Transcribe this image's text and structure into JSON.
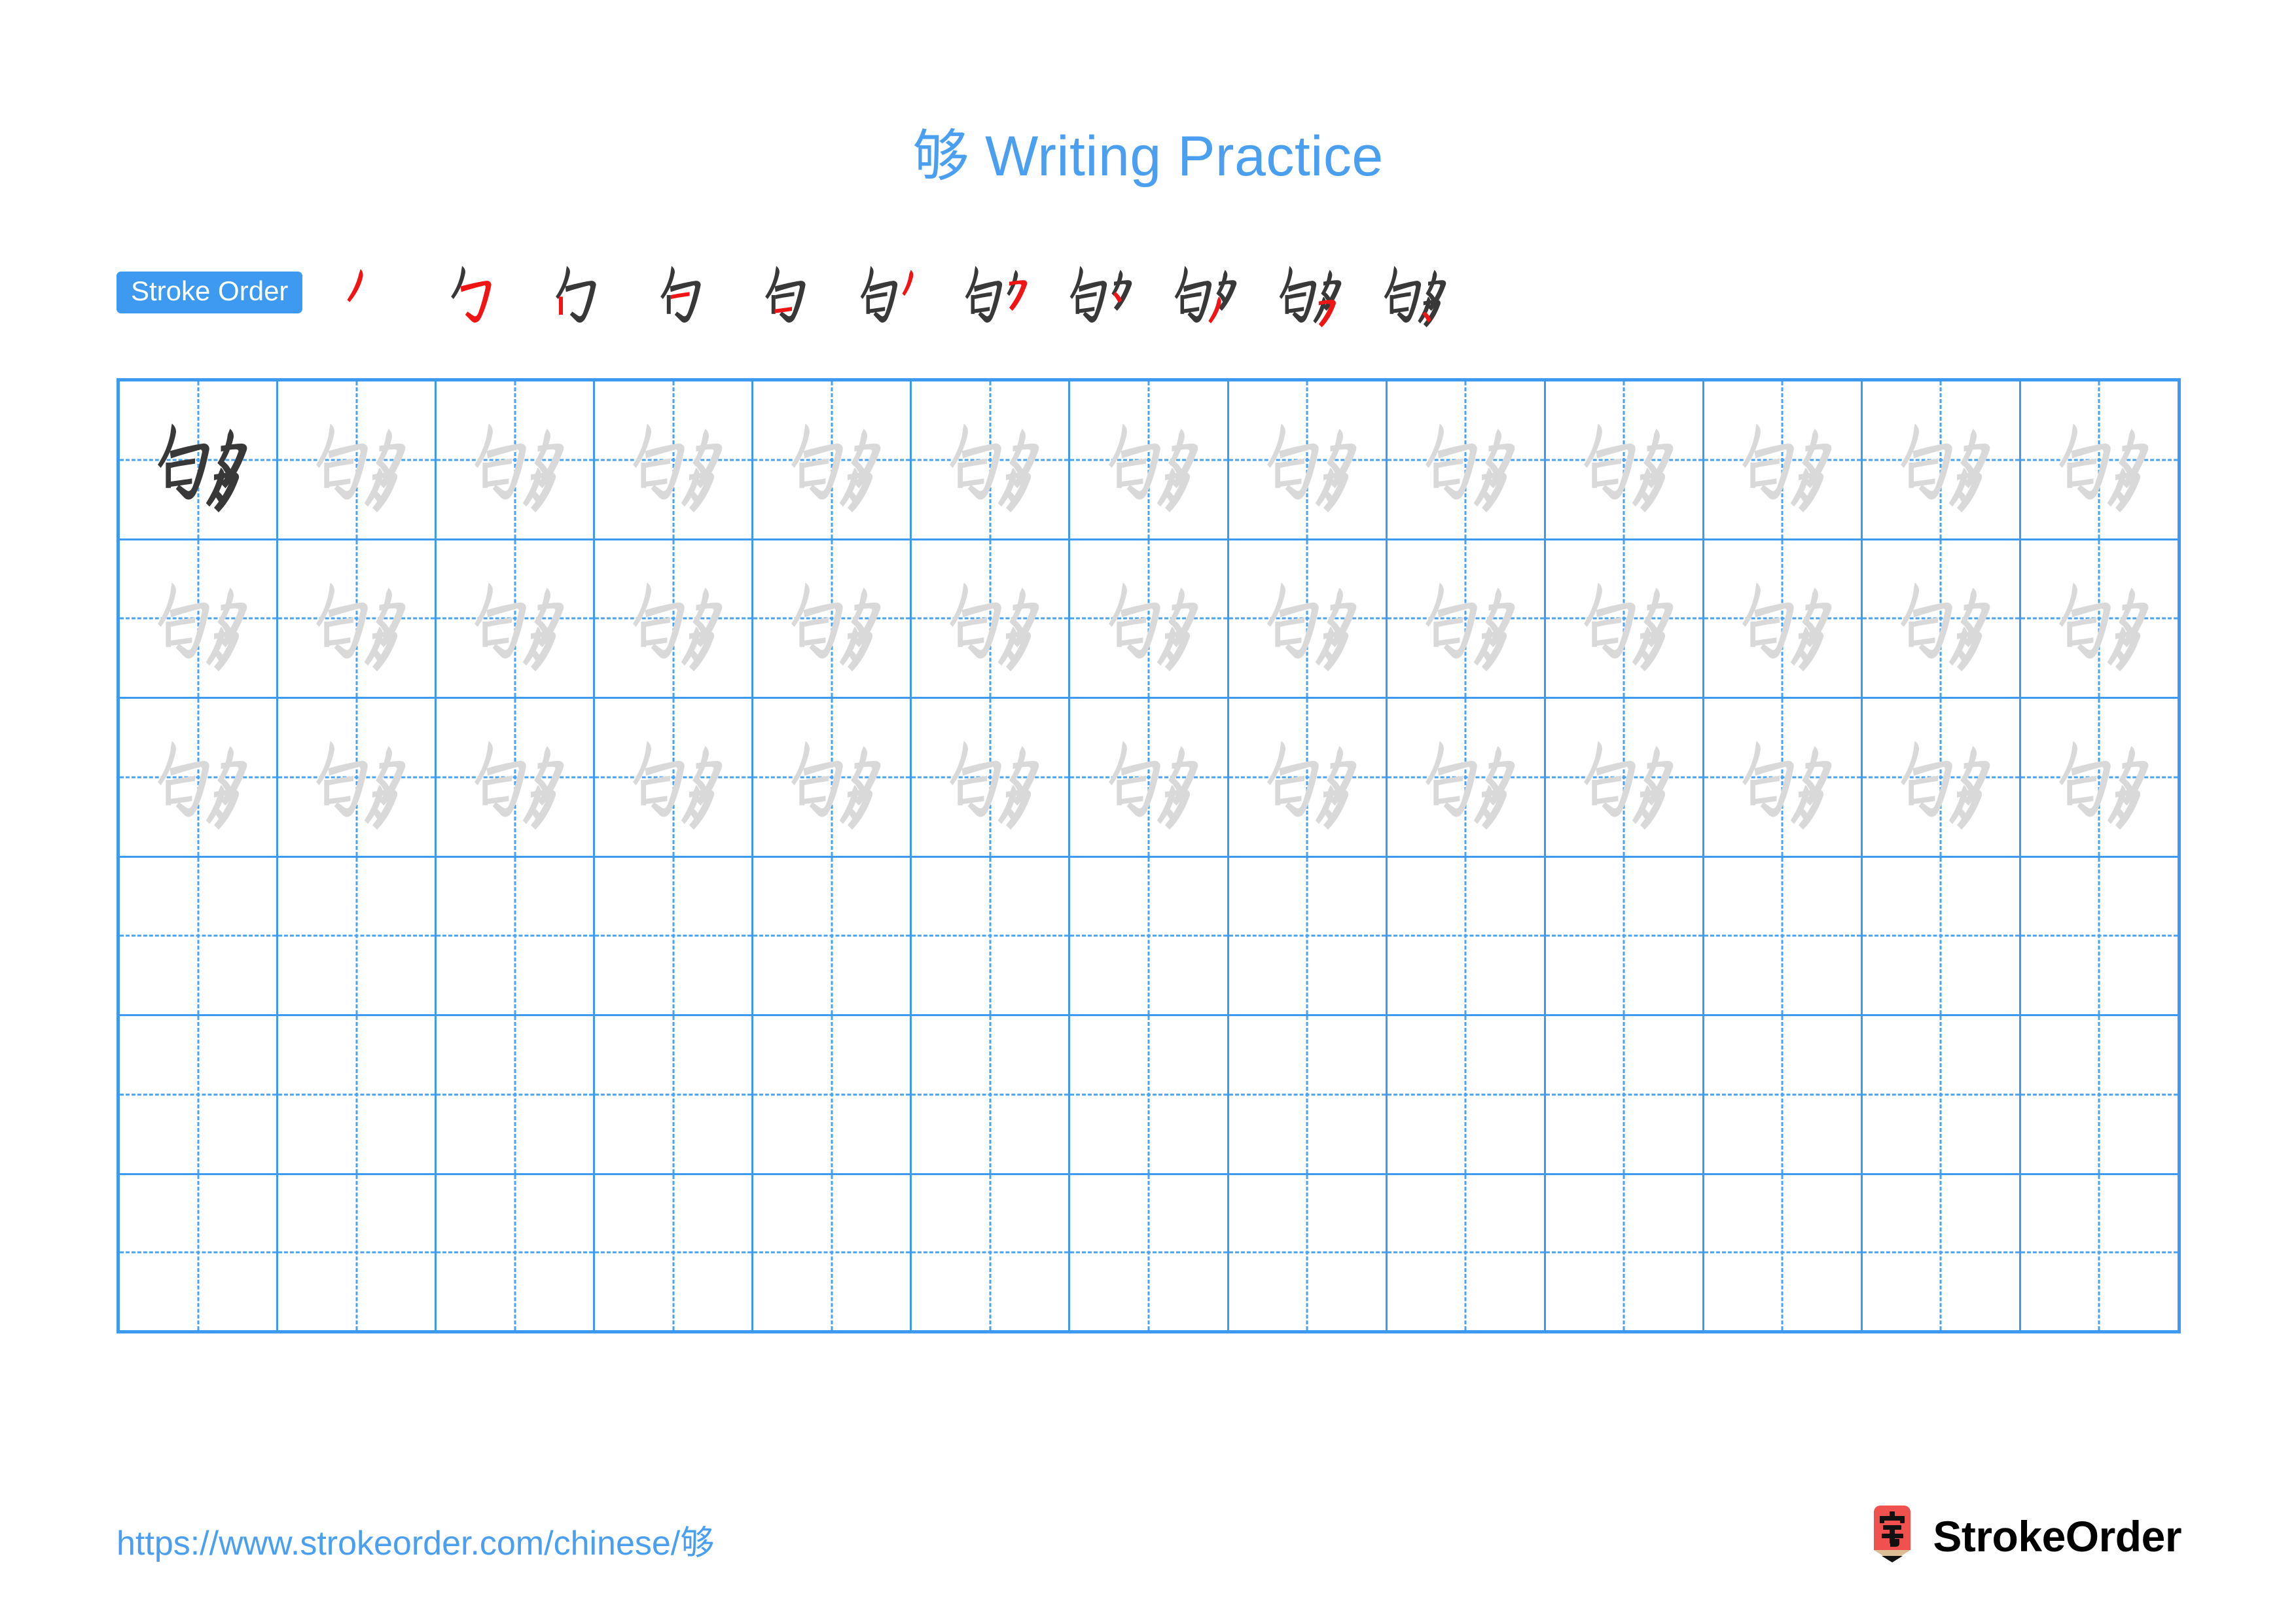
{
  "page": {
    "character": "够",
    "title": "够 Writing Practice",
    "title_character": "够",
    "title_text": " Writing Practice",
    "background_color": "#ffffff",
    "accent_color": "#4a9ff0"
  },
  "stroke_order": {
    "label": "Stroke Order",
    "badge_bg_color": "#3e9af0",
    "badge_text_color": "#ffffff",
    "total_strokes": 11,
    "new_stroke_color": "#f01414",
    "prior_stroke_color": "#383838",
    "steps": [
      {
        "index": 1,
        "strokes_shown": 1,
        "new_stroke_name": "pie"
      },
      {
        "index": 2,
        "strokes_shown": 2,
        "new_stroke_name": "heng-zhe-gou"
      },
      {
        "index": 3,
        "strokes_shown": 3,
        "new_stroke_name": "shu"
      },
      {
        "index": 4,
        "strokes_shown": 4,
        "new_stroke_name": "heng"
      },
      {
        "index": 5,
        "strokes_shown": 5,
        "new_stroke_name": "heng"
      },
      {
        "index": 6,
        "strokes_shown": 6,
        "new_stroke_name": "pie"
      },
      {
        "index": 7,
        "strokes_shown": 7,
        "new_stroke_name": "heng-pie"
      },
      {
        "index": 8,
        "strokes_shown": 8,
        "new_stroke_name": "dian"
      },
      {
        "index": 9,
        "strokes_shown": 9,
        "new_stroke_name": "pie"
      },
      {
        "index": 10,
        "strokes_shown": 10,
        "new_stroke_name": "heng-pie"
      },
      {
        "index": 11,
        "strokes_shown": 11,
        "new_stroke_name": "dian"
      }
    ]
  },
  "practice_grid": {
    "columns": 13,
    "rows": 6,
    "filled_rows": 3,
    "empty_rows": 3,
    "grid_line_color": "#3e9af0",
    "guide_line_color": "#4aa3f2",
    "dark_glyph_color": "#383838",
    "light_glyph_color": "#d9d9d9",
    "cells": [
      [
        "dark",
        "light",
        "light",
        "light",
        "light",
        "light",
        "light",
        "light",
        "light",
        "light",
        "light",
        "light",
        "light"
      ],
      [
        "light",
        "light",
        "light",
        "light",
        "light",
        "light",
        "light",
        "light",
        "light",
        "light",
        "light",
        "light",
        "light"
      ],
      [
        "light",
        "light",
        "light",
        "light",
        "light",
        "light",
        "light",
        "light",
        "light",
        "light",
        "light",
        "light",
        "light"
      ],
      [
        "empty",
        "empty",
        "empty",
        "empty",
        "empty",
        "empty",
        "empty",
        "empty",
        "empty",
        "empty",
        "empty",
        "empty",
        "empty"
      ],
      [
        "empty",
        "empty",
        "empty",
        "empty",
        "empty",
        "empty",
        "empty",
        "empty",
        "empty",
        "empty",
        "empty",
        "empty",
        "empty"
      ],
      [
        "empty",
        "empty",
        "empty",
        "empty",
        "empty",
        "empty",
        "empty",
        "empty",
        "empty",
        "empty",
        "empty",
        "empty",
        "empty"
      ]
    ]
  },
  "footer": {
    "url": "https://www.strokeorder.com/chinese/够",
    "url_prefix": "https://www.strokeorder.com/chinese/",
    "url_character": "够",
    "url_color": "#4a9ff0",
    "brand_name": "StrokeOrder",
    "brand_icon_character": "字",
    "brand_icon_body_color": "#f0514e",
    "brand_icon_tip_color": "#dcbe96",
    "brand_icon_point_color": "#111111",
    "brand_text_color": "#000000"
  }
}
